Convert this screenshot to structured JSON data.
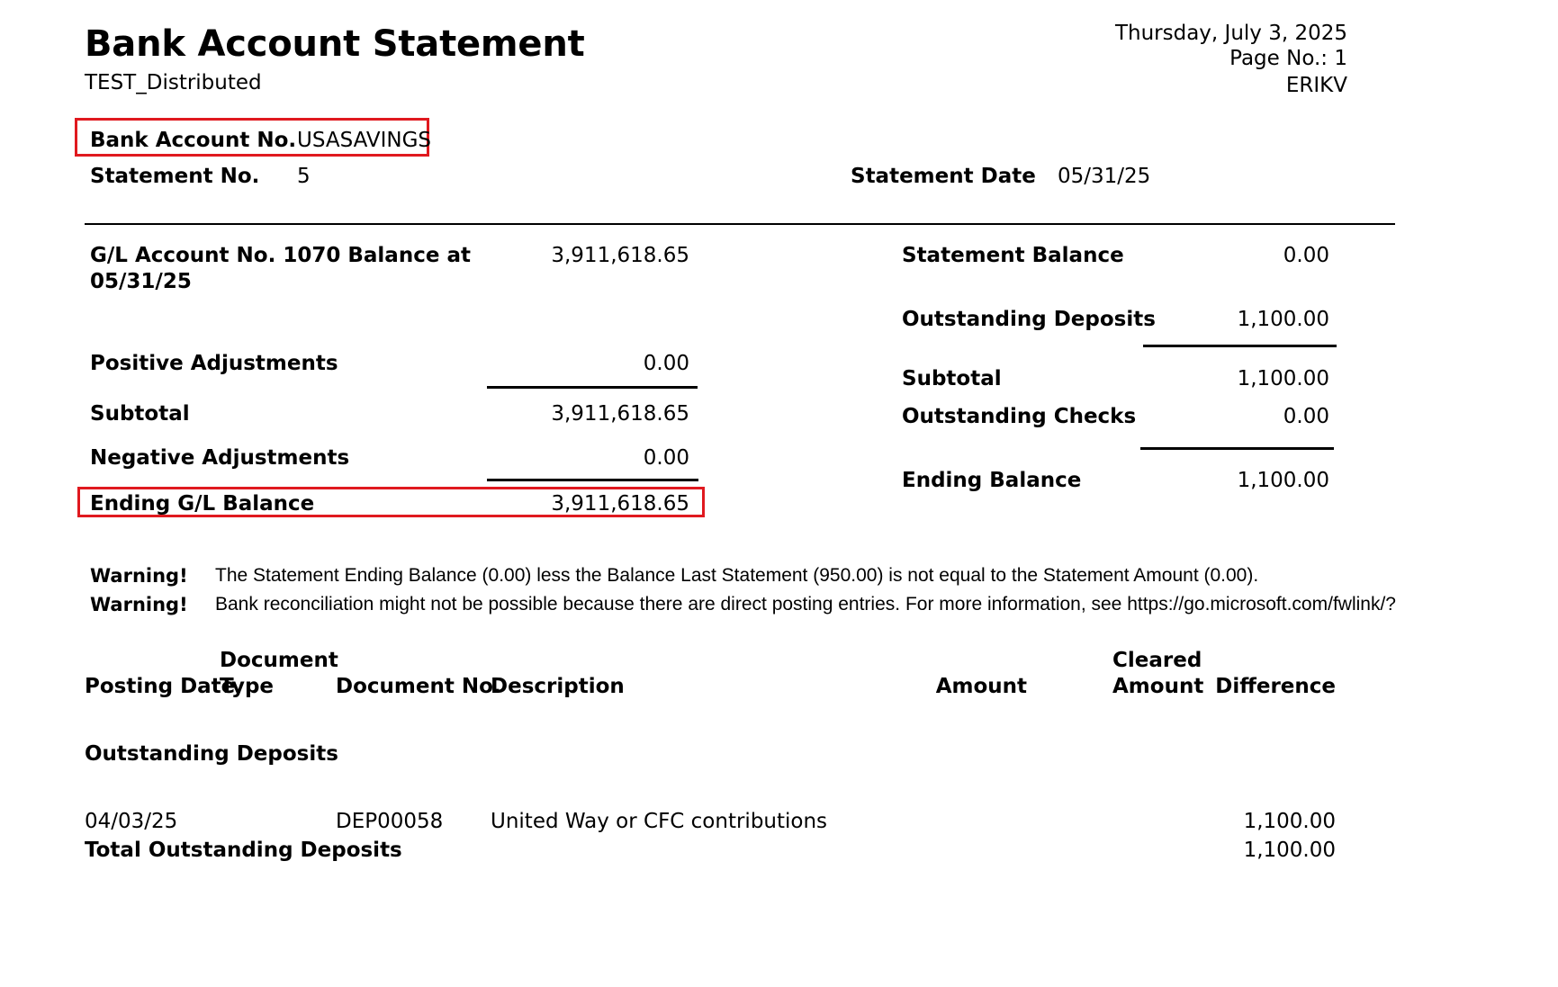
{
  "header": {
    "title": "Bank Account Statement",
    "company": "TEST_Distributed",
    "date": "Thursday, July 3, 2025",
    "page_no": "Page No.: 1",
    "user": "ERIKV"
  },
  "account": {
    "bank_account_label": "Bank Account No.",
    "bank_account_value": "USASAVINGS",
    "statement_no_label": "Statement No.",
    "statement_no_value": "5",
    "statement_date_label": "Statement Date",
    "statement_date_value": "05/31/25"
  },
  "gl_section": {
    "gl_balance_label_line1": "G/L Account No. 1070 Balance at",
    "gl_balance_label_line2": "05/31/25",
    "gl_balance_value": "3,911,618.65",
    "positive_adj_label": "Positive Adjustments",
    "positive_adj_value": "0.00",
    "subtotal_label": "Subtotal",
    "subtotal_value": "3,911,618.65",
    "negative_adj_label": "Negative Adjustments",
    "negative_adj_value": "0.00",
    "ending_gl_label": "Ending G/L Balance",
    "ending_gl_value": "3,911,618.65"
  },
  "statement_section": {
    "statement_balance_label": "Statement Balance",
    "statement_balance_value": "0.00",
    "outstanding_deposits_label": "Outstanding Deposits",
    "outstanding_deposits_value": "1,100.00",
    "subtotal_label": "Subtotal",
    "subtotal_value": "1,100.00",
    "outstanding_checks_label": "Outstanding Checks",
    "outstanding_checks_value": "0.00",
    "ending_balance_label": "Ending Balance",
    "ending_balance_value": "1,100.00"
  },
  "warnings": [
    {
      "label": "Warning!",
      "text": "The Statement Ending Balance (0.00) less the Balance Last Statement (950.00) is not equal to the Statement Amount (0.00)."
    },
    {
      "label": "Warning!",
      "text": "Bank reconciliation might not be possible because there are direct posting entries. For more information, see https://go.microsoft.com/fwlink/?"
    }
  ],
  "table": {
    "headers": {
      "posting_date": "Posting Date",
      "document_type_line1": "Document",
      "document_type_line2": "Type",
      "document_no": "Document No.",
      "description": "Description",
      "amount": "Amount",
      "cleared_amount_line1": "Cleared",
      "cleared_amount_line2": "Amount",
      "difference": "Difference"
    },
    "group_title": "Outstanding Deposits",
    "rows": [
      {
        "posting_date": "04/03/25",
        "document_type": "",
        "document_no": "DEP00058",
        "description": "United Way or CFC contributions",
        "amount": "",
        "cleared_amount": "",
        "difference": "1,100.00"
      }
    ],
    "total_label": "Total Outstanding Deposits",
    "total_value": "1,100.00"
  },
  "colors": {
    "highlight": "#e0191f",
    "text": "#000000"
  }
}
